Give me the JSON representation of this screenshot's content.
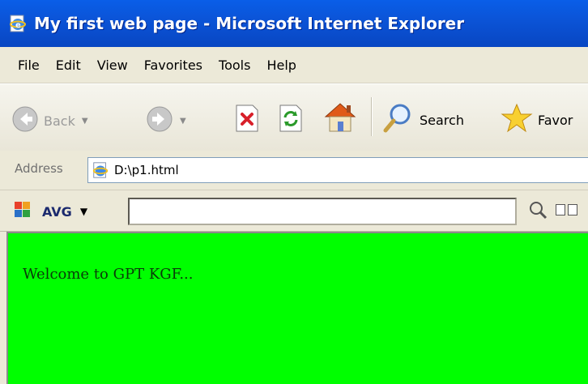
{
  "window": {
    "title": "My first web page - Microsoft Internet Explorer"
  },
  "menu": {
    "items": [
      {
        "label": "File"
      },
      {
        "label": "Edit"
      },
      {
        "label": "View"
      },
      {
        "label": "Favorites"
      },
      {
        "label": "Tools"
      },
      {
        "label": "Help"
      }
    ]
  },
  "toolbar": {
    "back_label": "Back",
    "search_label": "Search",
    "favorites_label": "Favor"
  },
  "address": {
    "label": "Address",
    "value": "D:\\p1.html"
  },
  "avg": {
    "label": "AVG",
    "search_value": ""
  },
  "page": {
    "welcome_text": "Welcome to GPT KGF...",
    "background_color": "#00ff00"
  }
}
